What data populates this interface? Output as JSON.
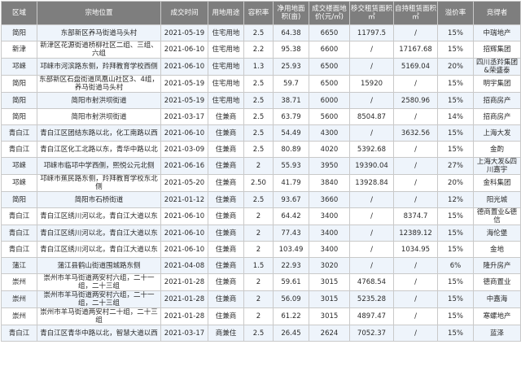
{
  "headers": [
    "区域",
    "宗地位置",
    "成交时间",
    "用地用途",
    "容积率",
    "净用地面积(亩)",
    "成交楼面地价(元/㎡)",
    "移交租赁面积㎡",
    "自持租赁面积㎡",
    "溢价率",
    "竞得者"
  ],
  "rows": [
    [
      "简阳",
      "东部新区养马街道马头村",
      "2021-05-19",
      "住宅用地",
      "2.5",
      "64.38",
      "6650",
      "11797.5",
      "/",
      "15%",
      "中瑞地产"
    ],
    [
      "新津",
      "新津区花源街道桥柳社区二组、三组、六组",
      "2021-06-10",
      "住宅用地",
      "2.2",
      "95.38",
      "6600",
      "/",
      "17167.68",
      "15%",
      "招辉集团"
    ],
    [
      "邛崃",
      "邛崃市河滨路东侧，羚拜教育学校西侧",
      "2021-06-10",
      "住宅用地",
      "1.3",
      "25.93",
      "6500",
      "/",
      "5169.04",
      "20%",
      "四川丞羚集团&荣盛泰"
    ],
    [
      "简阳",
      "东部新区石盘街道凤凰山社区3、4组，养马街道马头村",
      "2021-05-19",
      "住宅用地",
      "2.5",
      "59.7",
      "6500",
      "15920",
      "/",
      "15%",
      "明宇集团"
    ],
    [
      "简阳",
      "简阳市射洪坝街道",
      "2021-05-19",
      "住宅用地",
      "2.5",
      "38.71",
      "6000",
      "/",
      "2580.96",
      "15%",
      "招商房产"
    ],
    [
      "简阳",
      "简阳市射洪坝街道",
      "2021-03-17",
      "住兼商",
      "2.5",
      "63.79",
      "5600",
      "8504.87",
      "/",
      "14%",
      "招商房产"
    ],
    [
      "青白江",
      "青白江区团结东路以北，化工南路以西",
      "2021-06-10",
      "住兼商",
      "2.5",
      "54.49",
      "4300",
      "/",
      "3632.56",
      "15%",
      "上海大发"
    ],
    [
      "青白江",
      "青白江区化工北路以东，青华中路以北",
      "2021-03-09",
      "住兼商",
      "2.5",
      "80.89",
      "4020",
      "5392.68",
      "/",
      "15%",
      "金酌"
    ],
    [
      "邛崃",
      "邛崃市临邛中学西侧，熙悦公元北侧",
      "2021-06-16",
      "住兼商",
      "2",
      "55.93",
      "3950",
      "19390.04",
      "/",
      "27%",
      "上海大发&四川嘉宇"
    ],
    [
      "邛崃",
      "邛崃市蕉民路东侧，羚拜教育学校东北侧",
      "2021-05-20",
      "住兼商",
      "2.50",
      "41.79",
      "3840",
      "13928.84",
      "/",
      "20%",
      "金科集团"
    ],
    [
      "简阳",
      "简阳市石桥街道",
      "2021-01-12",
      "住兼商",
      "2.5",
      "93.67",
      "3660",
      "/",
      "/",
      "12%",
      "阳光城"
    ],
    [
      "青白江",
      "青白江区绣川河以北，青白江大道以东",
      "2021-06-10",
      "住兼商",
      "2",
      "64.42",
      "3400",
      "/",
      "8374.7",
      "15%",
      "德商置业&德信"
    ],
    [
      "青白江",
      "青白江区绣川河以北，青白江大道以东",
      "2021-06-10",
      "住兼商",
      "2",
      "77.43",
      "3400",
      "/",
      "12389.12",
      "15%",
      "海伦堡"
    ],
    [
      "青白江",
      "青白江区绣川河以北，青白江大道以东",
      "2021-06-10",
      "住兼商",
      "2",
      "103.49",
      "3400",
      "/",
      "1034.95",
      "15%",
      "金地"
    ],
    [
      "蒲江",
      "蒲江县鹤山街道围城路东侧",
      "2021-04-08",
      "住兼商",
      "1.5",
      "22.93",
      "3020",
      "/",
      "/",
      "6%",
      "隆升房产"
    ],
    [
      "崇州",
      "崇州市羊马街道两安村六组，二十一组，二十三组",
      "2021-01-28",
      "住兼商",
      "2",
      "59.61",
      "3015",
      "4768.54",
      "/",
      "15%",
      "德商置业"
    ],
    [
      "崇州",
      "崇州市羊马街道两安村六组，二十一组，二十三组",
      "2021-01-28",
      "住兼商",
      "2",
      "56.09",
      "3015",
      "5235.28",
      "/",
      "15%",
      "中嘉海"
    ],
    [
      "崇州",
      "崇州市羊马街道两安村二十组，二十三组",
      "2021-01-28",
      "住兼商",
      "2",
      "61.22",
      "3015",
      "4897.47",
      "/",
      "15%",
      "寒螺地产"
    ],
    [
      "青白江",
      "青白江区青华中路以北，智慧大道以西",
      "2021-03-17",
      "商兼住",
      "2.5",
      "26.45",
      "2624",
      "7052.37",
      "/",
      "15%",
      "蓝泽"
    ]
  ]
}
